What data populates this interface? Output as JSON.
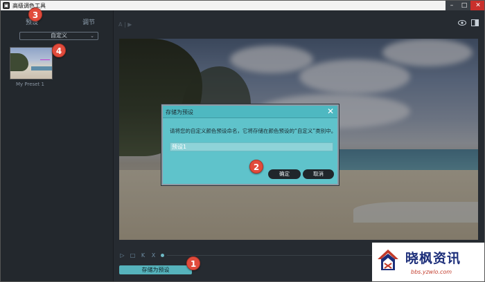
{
  "window": {
    "title": "高级调色工具"
  },
  "left_panel": {
    "tabs": [
      {
        "label": "预设"
      },
      {
        "label": "调节"
      }
    ],
    "preset_dropdown": {
      "selected": "自定义"
    },
    "presets": [
      {
        "label": "My Preset 1"
      }
    ]
  },
  "preview": {
    "header": "A | ▶"
  },
  "dialog": {
    "title": "存储为预设",
    "message": "请将您的自定义颜色预设命名，它将存储在颜色预设的“自定义”类别中。",
    "input_value": "预设1",
    "ok_label": "确定",
    "cancel_label": "取消"
  },
  "playback": {
    "play": "▷",
    "stop": "□",
    "mark_in": "K",
    "mark_out": "X"
  },
  "footer": {
    "save_preset_label": "存储为预设"
  },
  "annotations": [
    {
      "label": "1"
    },
    {
      "label": "2"
    },
    {
      "label": "3"
    },
    {
      "label": "4"
    }
  ],
  "watermark": {
    "brand": "晓枫资讯",
    "url": "bbs.yzwlo.com"
  },
  "colors": {
    "accent": "#56b3bc",
    "dialog_bg": "#5fc3cb",
    "badge": "#e14b3c",
    "panel": "#23282d"
  }
}
